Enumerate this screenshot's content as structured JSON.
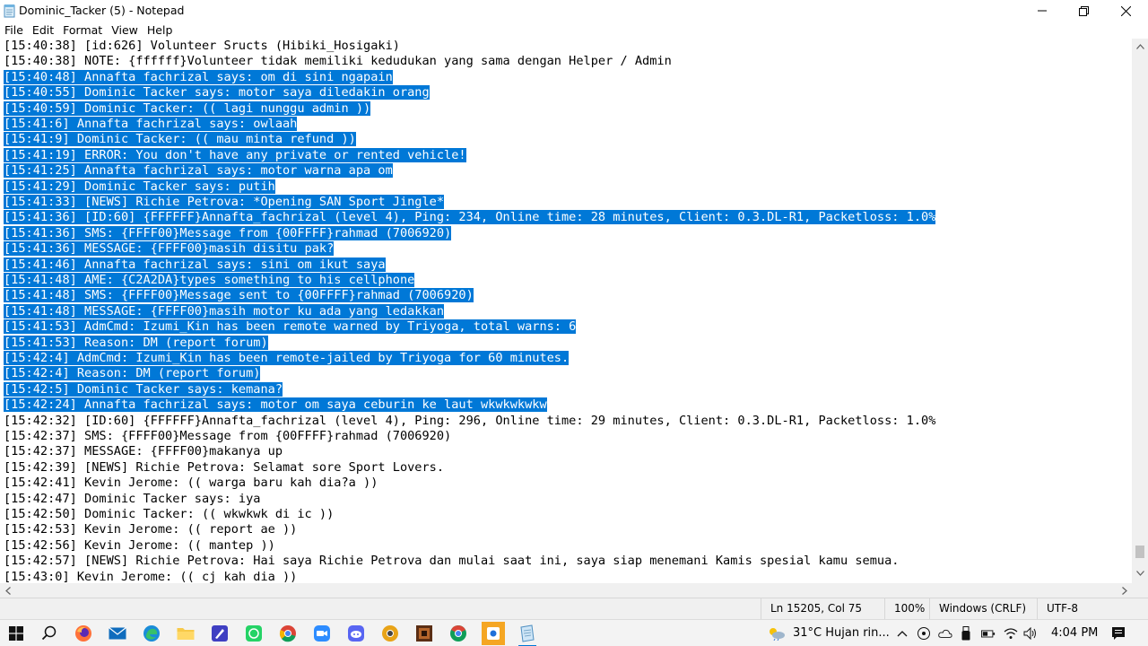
{
  "window": {
    "title": "Dominic_Tacker (5) - Notepad"
  },
  "menu": [
    "File",
    "Edit",
    "Format",
    "View",
    "Help"
  ],
  "lines": [
    {
      "text": "[15:40:38] [id:626] Volunteer Sructs (Hibiki_Hosigaki)",
      "selected": false
    },
    {
      "text": "[15:40:38] NOTE: {ffffff}Volunteer tidak memiliki kedudukan yang sama dengan Helper / Admin",
      "selected": false
    },
    {
      "text": "[15:40:48] Annafta fachrizal says: om di sini ngapain",
      "selected": true
    },
    {
      "text": "[15:40:55] Dominic Tacker says: motor saya diledakin orang",
      "selected": true
    },
    {
      "text": "[15:40:59] Dominic Tacker: (( lagi nunggu admin ))",
      "selected": true
    },
    {
      "text": "[15:41:6] Annafta fachrizal says: owlaah",
      "selected": true
    },
    {
      "text": "[15:41:9] Dominic Tacker: (( mau minta refund ))",
      "selected": true
    },
    {
      "text": "[15:41:19] ERROR: You don't have any private or rented vehicle!",
      "selected": true
    },
    {
      "text": "[15:41:25] Annafta fachrizal says: motor warna apa om",
      "selected": true
    },
    {
      "text": "[15:41:29] Dominic Tacker says: putih",
      "selected": true
    },
    {
      "text": "[15:41:33] [NEWS] Richie Petrova: *Opening SAN Sport Jingle*",
      "selected": true
    },
    {
      "text": "[15:41:36] [ID:60] {FFFFFF}Annafta_fachrizal (level 4), Ping: 234, Online time: 28 minutes, Client: 0.3.DL-R1, Packetloss: 1.0%",
      "selected": true
    },
    {
      "text": "[15:41:36] SMS: {FFFF00}Message from {00FFFF}rahmad (7006920)",
      "selected": true
    },
    {
      "text": "[15:41:36] MESSAGE: {FFFF00}masih disitu pak?",
      "selected": true
    },
    {
      "text": "[15:41:46] Annafta fachrizal says: sini om ikut saya",
      "selected": true
    },
    {
      "text": "[15:41:48] AME: {C2A2DA}types something to his cellphone",
      "selected": true
    },
    {
      "text": "[15:41:48] SMS: {FFFF00}Message sent to {00FFFF}rahmad (7006920)",
      "selected": true
    },
    {
      "text": "[15:41:48] MESSAGE: {FFFF00}masih motor ku ada yang ledakkan",
      "selected": true
    },
    {
      "text": "[15:41:53] AdmCmd: Izumi_Kin has been remote warned by Triyoga, total warns: 6",
      "selected": true
    },
    {
      "text": "[15:41:53] Reason: DM (report forum)",
      "selected": true
    },
    {
      "text": "[15:42:4] AdmCmd: Izumi_Kin has been remote-jailed by Triyoga for 60 minutes.",
      "selected": true
    },
    {
      "text": "[15:42:4] Reason: DM (report forum)",
      "selected": true
    },
    {
      "text": "[15:42:5] Dominic Tacker says: kemana?",
      "selected": true
    },
    {
      "text": "[15:42:24] Annafta fachrizal says: motor om saya ceburin ke laut wkwkwkwkw",
      "selected": true
    },
    {
      "text": "[15:42:32] [ID:60] {FFFFFF}Annafta_fachrizal (level 4), Ping: 296, Online time: 29 minutes, Client: 0.3.DL-R1, Packetloss: 1.0%",
      "selected": false
    },
    {
      "text": "[15:42:37] SMS: {FFFF00}Message from {00FFFF}rahmad (7006920)",
      "selected": false
    },
    {
      "text": "[15:42:37] MESSAGE: {FFFF00}makanya up",
      "selected": false
    },
    {
      "text": "[15:42:39] [NEWS] Richie Petrova: Selamat sore Sport Lovers.",
      "selected": false
    },
    {
      "text": "[15:42:41] Kevin Jerome: (( warga baru kah dia?a ))",
      "selected": false
    },
    {
      "text": "[15:42:47] Dominic Tacker says: iya",
      "selected": false
    },
    {
      "text": "[15:42:50] Dominic Tacker: (( wkwkwk di ic ))",
      "selected": false
    },
    {
      "text": "[15:42:53] Kevin Jerome: (( report ae ))",
      "selected": false
    },
    {
      "text": "[15:42:56] Kevin Jerome: (( mantep ))",
      "selected": false
    },
    {
      "text": "[15:42:57] [NEWS] Richie Petrova: Hai saya Richie Petrova dan mulai saat ini, saya siap menemani Kamis spesial kamu semua.",
      "selected": false
    },
    {
      "text": "[15:43:0] Kevin Jerome: (( cj kah dia ))",
      "selected": false
    }
  ],
  "status": {
    "position": "Ln 15205, Col 75",
    "zoom": "100%",
    "line_ending": "Windows (CRLF)",
    "encoding": "UTF-8"
  },
  "taskbar": {
    "weather": "31°C  Hujan rin...",
    "time": "4:04 PM",
    "apps": [
      "windows-start",
      "search",
      "firefox",
      "mail",
      "edge",
      "file-explorer",
      "pen-app",
      "whatsapp",
      "chrome",
      "zoom",
      "discord",
      "chrome-canary",
      "game-app",
      "chrome-2",
      "active-app",
      "notepad"
    ]
  },
  "colors": {
    "selection": "#0078d7",
    "selection_text": "#ffffff",
    "background": "#ffffff"
  }
}
